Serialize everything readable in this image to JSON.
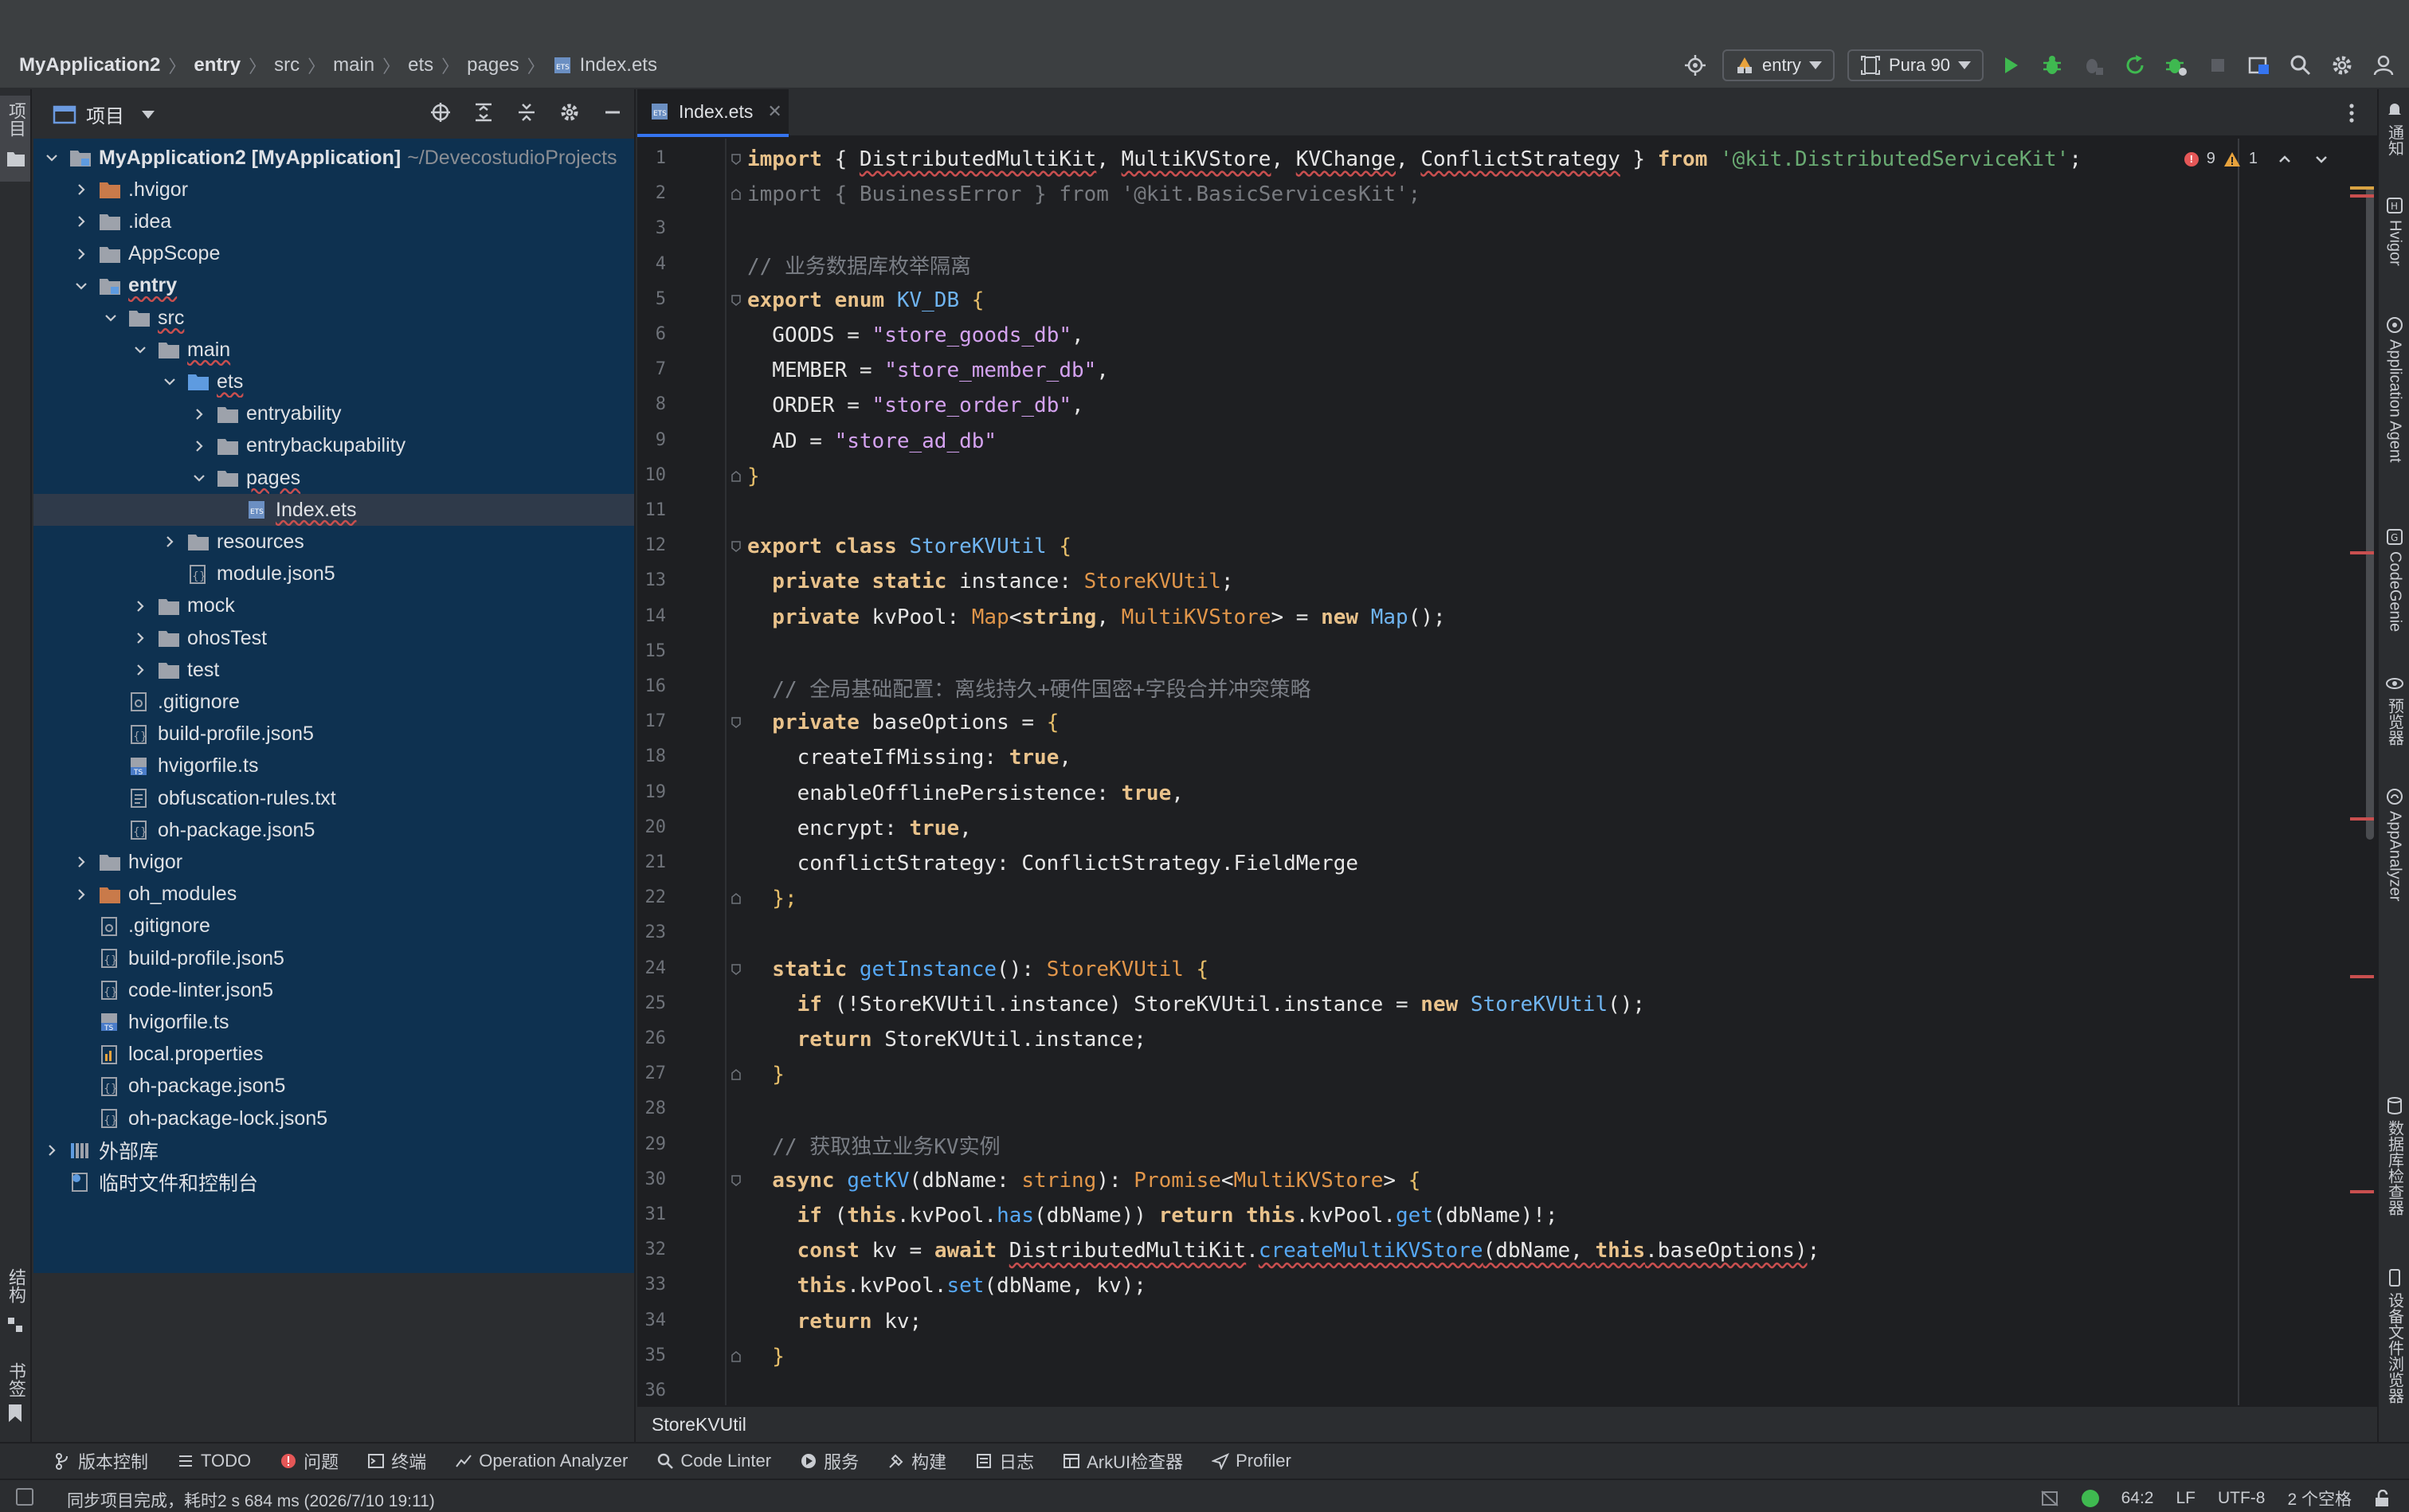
{
  "breadcrumb": [
    "MyApplication2",
    "entry",
    "src",
    "main",
    "ets",
    "pages",
    "Index.ets"
  ],
  "toolbar": {
    "module_combo": "entry",
    "device_combo": "Pura 90"
  },
  "left_stripe": {
    "project_label": "项目",
    "structure_label": "结构",
    "bookmarks_label": "书签"
  },
  "project_panel": {
    "title": "项目",
    "tree": [
      {
        "label": "MyApplication2 [MyApplication]",
        "extra": "~/DevecostudioProjects",
        "depth": 0,
        "chevron": "down",
        "icon": "module",
        "bold": true
      },
      {
        "label": ".hvigor",
        "depth": 1,
        "chevron": "right",
        "icon": "folder-orange"
      },
      {
        "label": ".idea",
        "depth": 1,
        "chevron": "right",
        "icon": "folder"
      },
      {
        "label": "AppScope",
        "depth": 1,
        "chevron": "right",
        "icon": "folder"
      },
      {
        "label": "entry",
        "depth": 1,
        "chevron": "down",
        "icon": "module",
        "bold": true,
        "wavy": true
      },
      {
        "label": "src",
        "depth": 2,
        "chevron": "down",
        "icon": "folder",
        "wavy": true
      },
      {
        "label": "main",
        "depth": 3,
        "chevron": "down",
        "icon": "folder",
        "wavy": true
      },
      {
        "label": "ets",
        "depth": 4,
        "chevron": "down",
        "icon": "folder-blue",
        "wavy": true
      },
      {
        "label": "entryability",
        "depth": 5,
        "chevron": "right",
        "icon": "folder"
      },
      {
        "label": "entrybackupability",
        "depth": 5,
        "chevron": "right",
        "icon": "folder"
      },
      {
        "label": "pages",
        "depth": 5,
        "chevron": "down",
        "icon": "folder",
        "wavy": true
      },
      {
        "label": "Index.ets",
        "depth": 6,
        "chevron": "none",
        "icon": "ets",
        "wavy": true,
        "selected": true
      },
      {
        "label": "resources",
        "depth": 4,
        "chevron": "right",
        "icon": "folder"
      },
      {
        "label": "module.json5",
        "depth": 4,
        "chevron": "none",
        "icon": "json"
      },
      {
        "label": "mock",
        "depth": 3,
        "chevron": "right",
        "icon": "folder"
      },
      {
        "label": "ohosTest",
        "depth": 3,
        "chevron": "right",
        "icon": "folder"
      },
      {
        "label": "test",
        "depth": 3,
        "chevron": "right",
        "icon": "folder"
      },
      {
        "label": ".gitignore",
        "depth": 2,
        "chevron": "none",
        "icon": "gitignore"
      },
      {
        "label": "build-profile.json5",
        "depth": 2,
        "chevron": "none",
        "icon": "json"
      },
      {
        "label": "hvigorfile.ts",
        "depth": 2,
        "chevron": "none",
        "icon": "ts"
      },
      {
        "label": "obfuscation-rules.txt",
        "depth": 2,
        "chevron": "none",
        "icon": "txt"
      },
      {
        "label": "oh-package.json5",
        "depth": 2,
        "chevron": "none",
        "icon": "json"
      },
      {
        "label": "hvigor",
        "depth": 1,
        "chevron": "right",
        "icon": "folder"
      },
      {
        "label": "oh_modules",
        "depth": 1,
        "chevron": "right",
        "icon": "folder-orange"
      },
      {
        "label": ".gitignore",
        "depth": 1,
        "chevron": "none",
        "icon": "gitignore"
      },
      {
        "label": "build-profile.json5",
        "depth": 1,
        "chevron": "none",
        "icon": "json"
      },
      {
        "label": "code-linter.json5",
        "depth": 1,
        "chevron": "none",
        "icon": "json"
      },
      {
        "label": "hvigorfile.ts",
        "depth": 1,
        "chevron": "none",
        "icon": "ts"
      },
      {
        "label": "local.properties",
        "depth": 1,
        "chevron": "none",
        "icon": "properties"
      },
      {
        "label": "oh-package.json5",
        "depth": 1,
        "chevron": "none",
        "icon": "json"
      },
      {
        "label": "oh-package-lock.json5",
        "depth": 1,
        "chevron": "none",
        "icon": "json"
      },
      {
        "label": "外部库",
        "depth": 0,
        "chevron": "right",
        "icon": "library"
      },
      {
        "label": "临时文件和控制台",
        "depth": 0,
        "chevron": "none",
        "icon": "scratch"
      }
    ]
  },
  "editor": {
    "tab_label": "Index.ets",
    "inspection": {
      "errors": "9",
      "warnings": "1"
    },
    "bottom_breadcrumb": "StoreKVUtil",
    "lines": [
      {
        "n": "1",
        "tokens": [
          [
            "k",
            "import"
          ],
          [
            "pl",
            " { "
          ],
          [
            "plw",
            "DistributedMultiKit"
          ],
          [
            "pl",
            ", "
          ],
          [
            "plw",
            "MultiKVStore"
          ],
          [
            "pl",
            ", "
          ],
          [
            "plw",
            "KVChange"
          ],
          [
            "pl",
            ", "
          ],
          [
            "plw",
            "ConflictStrategy"
          ],
          [
            "pl",
            " } "
          ],
          [
            "k",
            "from"
          ],
          [
            "pl",
            " "
          ],
          [
            "s2",
            "'@kit.DistributedServiceKit'"
          ],
          [
            "pl",
            ";"
          ]
        ]
      },
      {
        "n": "2",
        "tokens": [
          [
            "dim",
            "import { BusinessError } from '@kit.BasicServicesKit';"
          ]
        ]
      },
      {
        "n": "3",
        "tokens": []
      },
      {
        "n": "4",
        "tokens": [
          [
            "cm",
            "// 业务数据库枚举隔离"
          ]
        ]
      },
      {
        "n": "5",
        "tokens": [
          [
            "k",
            "export enum "
          ],
          [
            "ty",
            "KV_DB"
          ],
          [
            "br",
            " {"
          ]
        ]
      },
      {
        "n": "6",
        "tokens": [
          [
            "pl",
            "  GOODS = "
          ],
          [
            "str",
            "\"store_goods_db\""
          ],
          [
            "pl",
            ","
          ]
        ]
      },
      {
        "n": "7",
        "tokens": [
          [
            "pl",
            "  MEMBER = "
          ],
          [
            "str",
            "\"store_member_db\""
          ],
          [
            "pl",
            ","
          ]
        ]
      },
      {
        "n": "8",
        "tokens": [
          [
            "pl",
            "  ORDER = "
          ],
          [
            "str",
            "\"store_order_db\""
          ],
          [
            "pl",
            ","
          ]
        ]
      },
      {
        "n": "9",
        "tokens": [
          [
            "pl",
            "  AD = "
          ],
          [
            "str",
            "\"store_ad_db\""
          ]
        ]
      },
      {
        "n": "10",
        "tokens": [
          [
            "br",
            "}"
          ]
        ]
      },
      {
        "n": "11",
        "tokens": []
      },
      {
        "n": "12",
        "tokens": [
          [
            "k",
            "export class "
          ],
          [
            "ty",
            "StoreKVUtil"
          ],
          [
            "br",
            " {"
          ]
        ]
      },
      {
        "n": "13",
        "tokens": [
          [
            "k",
            "  private static "
          ],
          [
            "pl",
            "instance: "
          ],
          [
            "cls",
            "StoreKVUtil"
          ],
          [
            "pl",
            ";"
          ]
        ]
      },
      {
        "n": "14",
        "tokens": [
          [
            "k",
            "  private "
          ],
          [
            "pl",
            "kvPool: "
          ],
          [
            "cls",
            "Map"
          ],
          [
            "pl",
            "<"
          ],
          [
            "k",
            "string"
          ],
          [
            "pl",
            ", "
          ],
          [
            "cls",
            "MultiKVStore"
          ],
          [
            "pl",
            "> = "
          ],
          [
            "k",
            "new "
          ],
          [
            "ty",
            "Map"
          ],
          [
            "pl",
            "();"
          ]
        ]
      },
      {
        "n": "15",
        "tokens": []
      },
      {
        "n": "16",
        "tokens": [
          [
            "cm",
            "  // 全局基础配置：离线持久+硬件国密+字段合并冲突策略"
          ]
        ]
      },
      {
        "n": "17",
        "tokens": [
          [
            "k",
            "  private "
          ],
          [
            "pl",
            "baseOptions = "
          ],
          [
            "br",
            "{"
          ]
        ]
      },
      {
        "n": "18",
        "tokens": [
          [
            "pl",
            "    createIfMissing: "
          ],
          [
            "k",
            "true"
          ],
          [
            "pl",
            ","
          ]
        ]
      },
      {
        "n": "19",
        "tokens": [
          [
            "pl",
            "    enableOfflinePersistence: "
          ],
          [
            "k",
            "true"
          ],
          [
            "pl",
            ","
          ]
        ]
      },
      {
        "n": "20",
        "tokens": [
          [
            "pl",
            "    encrypt: "
          ],
          [
            "k",
            "true"
          ],
          [
            "pl",
            ","
          ]
        ]
      },
      {
        "n": "21",
        "tokens": [
          [
            "pl",
            "    conflictStrategy: ConflictStrategy.FieldMerge"
          ]
        ]
      },
      {
        "n": "22",
        "tokens": [
          [
            "br",
            "  };"
          ]
        ]
      },
      {
        "n": "23",
        "tokens": []
      },
      {
        "n": "24",
        "tokens": [
          [
            "k",
            "  static "
          ],
          [
            "fn",
            "getInstance"
          ],
          [
            "pl",
            "(): "
          ],
          [
            "cls",
            "StoreKVUtil"
          ],
          [
            "br",
            " {"
          ]
        ]
      },
      {
        "n": "25",
        "tokens": [
          [
            "k",
            "    if "
          ],
          [
            "pl",
            "(!StoreKVUtil.instance) StoreKVUtil.instance = "
          ],
          [
            "k",
            "new "
          ],
          [
            "ty",
            "StoreKVUtil"
          ],
          [
            "pl",
            "();"
          ]
        ]
      },
      {
        "n": "26",
        "tokens": [
          [
            "k",
            "    return "
          ],
          [
            "pl",
            "StoreKVUtil.instance;"
          ]
        ]
      },
      {
        "n": "27",
        "tokens": [
          [
            "br",
            "  }"
          ]
        ]
      },
      {
        "n": "28",
        "tokens": []
      },
      {
        "n": "29",
        "tokens": [
          [
            "cm",
            "  // 获取独立业务KV实例"
          ]
        ]
      },
      {
        "n": "30",
        "tokens": [
          [
            "k",
            "  async "
          ],
          [
            "fn",
            "getKV"
          ],
          [
            "pl",
            "(dbName: "
          ],
          [
            "cls",
            "string"
          ],
          [
            "pl",
            "): "
          ],
          [
            "cls",
            "Promise"
          ],
          [
            "pl",
            "<"
          ],
          [
            "cls",
            "MultiKVStore"
          ],
          [
            "pl",
            "> "
          ],
          [
            "br",
            "{"
          ]
        ]
      },
      {
        "n": "31",
        "tokens": [
          [
            "k",
            "    if "
          ],
          [
            "pl",
            "("
          ],
          [
            "k",
            "this"
          ],
          [
            "pl",
            ".kvPool."
          ],
          [
            "fn",
            "has"
          ],
          [
            "pl",
            "(dbName)) "
          ],
          [
            "k",
            "return this"
          ],
          [
            "pl",
            ".kvPool."
          ],
          [
            "fn",
            "get"
          ],
          [
            "pl",
            "(dbName)!;"
          ]
        ]
      },
      {
        "n": "32",
        "tokens": [
          [
            "k",
            "    const "
          ],
          [
            "pl",
            "kv = "
          ],
          [
            "k",
            "await "
          ],
          [
            "plw",
            "DistributedMultiKit"
          ],
          [
            "pl",
            "."
          ],
          [
            "fnw",
            "createMultiKVStore"
          ],
          [
            "plw",
            "(dbName, "
          ],
          [
            "kw2",
            "this"
          ],
          [
            "plw",
            ".baseOptions)"
          ],
          [
            "pl",
            ";"
          ]
        ]
      },
      {
        "n": "33",
        "tokens": [
          [
            "k",
            "    this"
          ],
          [
            "pl",
            ".kvPool."
          ],
          [
            "fn",
            "set"
          ],
          [
            "pl",
            "(dbName, kv);"
          ]
        ]
      },
      {
        "n": "34",
        "tokens": [
          [
            "k",
            "    return "
          ],
          [
            "pl",
            "kv;"
          ]
        ]
      },
      {
        "n": "35",
        "tokens": [
          [
            "br",
            "  }"
          ]
        ]
      },
      {
        "n": "36",
        "tokens": []
      }
    ]
  },
  "right_stripe": [
    "通知",
    "Hvigor",
    "Application Agent",
    "CodeGenie",
    "预览器",
    "AppAnalyzer",
    "数据库检查器",
    "设备文件浏览器"
  ],
  "bottom_tools": [
    "版本控制",
    "TODO",
    "问题",
    "终端",
    "Operation Analyzer",
    "Code Linter",
    "服务",
    "构建",
    "日志",
    "ArkUI检查器",
    "Profiler"
  ],
  "status": {
    "message": "同步项目完成，耗时2 s 684 ms (2026/7/10 19:11)",
    "position": "64:2",
    "line_sep": "LF",
    "encoding": "UTF-8",
    "indent": "2 个空格"
  },
  "colors": {
    "accent": "#3574f0",
    "selection": "#0e3150",
    "error": "#e55757",
    "run": "#3fb950"
  }
}
